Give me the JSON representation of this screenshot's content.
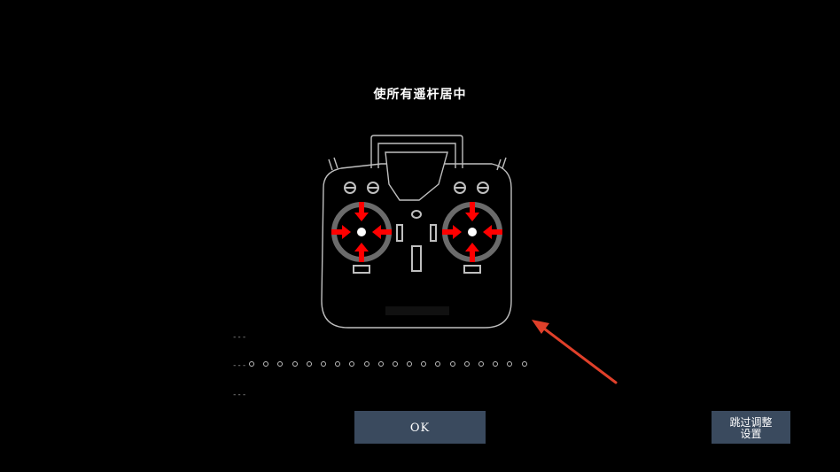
{
  "title": "使所有遥杆居中",
  "rows": {
    "top_label": "---",
    "middle_label": "---",
    "bottom_label": "---",
    "dot_count": 20
  },
  "buttons": {
    "ok_label": "OK",
    "skip_line1": "跳过调整",
    "skip_line2": "设置"
  },
  "icons": {
    "controller": "rc-transmitter-icon",
    "stick_arrows": "center-arrows-icon",
    "annotation": "pointer-arrow-icon"
  },
  "colors": {
    "background": "#000000",
    "outline": "#bfbfbf",
    "stick_ring": "#6b6b6b",
    "arrow_red": "#ff0000",
    "annotation_red": "#e0402a",
    "button_bg": "#3a4a5e"
  }
}
